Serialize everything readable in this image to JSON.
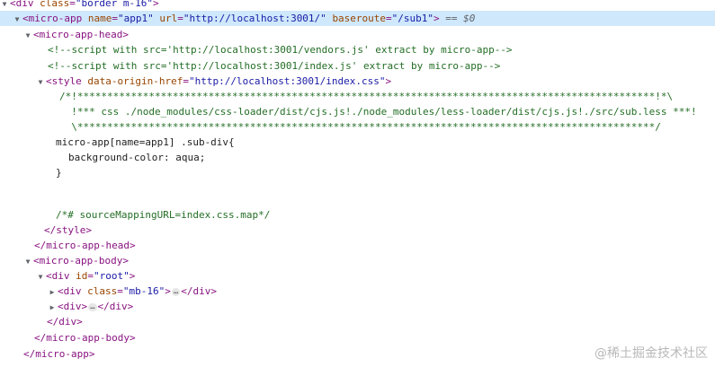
{
  "tree": {
    "l1_tag": "div",
    "l1_attr": "class",
    "l1_val": "\"border m-16\"",
    "l2_tag": "micro-app",
    "l2_a1": "name",
    "l2_v1": "\"app1\"",
    "l2_a2": "url",
    "l2_v2": "\"http://localhost:3001/\"",
    "l2_a3": "baseroute",
    "l2_v3": "\"/sub1\"",
    "l2_eq": "== $0",
    "l3_tag": "micro-app-head",
    "comment1": "<!--script with src='http://localhost:3001/vendors.js' extract by micro-app-->",
    "comment2": "<!--script with src='http://localhost:3001/index.js' extract by micro-app-->",
    "style_tag": "style",
    "style_attr": "data-origin-href",
    "style_val": "\"http://localhost:3001/index.css\"",
    "css1": "/*!*************************************************************************************************!*\\",
    "css2": "  !*** css ./node_modules/css-loader/dist/cjs.js!./node_modules/less-loader/dist/cjs.js!./src/sub.less ***!",
    "css3": "  \\*************************************************************************************************/",
    "css4": "micro-app[name=app1] .sub-div{",
    "css5_prop": "background-color",
    "css5_val": " aqua;",
    "css6": "}",
    "css7": "/*# sourceMappingURL=index.css.map*/",
    "close_style": "style",
    "close_head": "micro-app-head",
    "body_tag": "micro-app-body",
    "root_tag": "div",
    "root_attr": "id",
    "root_val": "\"root\"",
    "child1_tag": "div",
    "child1_attr": "class",
    "child1_val": "\"mb-16\"",
    "child1_ellipsis": "…",
    "child2_tag": "div",
    "child2_ellipsis": "…",
    "close_div": "div",
    "close_body": "micro-app-body",
    "close_app": "micro-app"
  },
  "watermark": "@稀土掘金技术社区"
}
